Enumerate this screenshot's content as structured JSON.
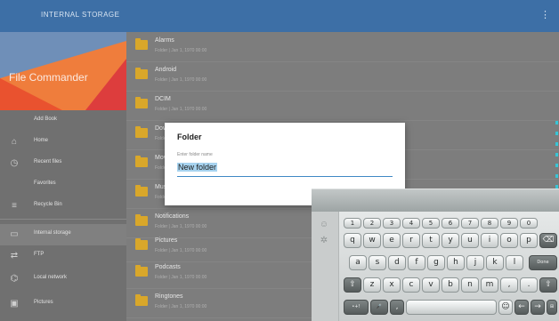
{
  "topbar": {
    "title": "INTERNAL STORAGE",
    "menu_icon": "more-vert-icon"
  },
  "sidebar": {
    "app_title": "File Commander",
    "items": [
      {
        "label": "Add Book",
        "icon": "add-icon"
      },
      {
        "label": "Home",
        "icon": "home-icon"
      },
      {
        "label": "Recent files",
        "icon": "clock-icon"
      },
      {
        "label": "Favorites",
        "icon": "star-icon"
      },
      {
        "label": "Recycle Bin",
        "icon": "trash-icon"
      },
      {
        "label": "Internal storage",
        "icon": "storage-icon"
      },
      {
        "label": "FTP",
        "icon": "ftp-icon"
      },
      {
        "label": "Local network",
        "icon": "network-icon"
      },
      {
        "label": "Pictures",
        "icon": "picture-icon"
      }
    ]
  },
  "files": [
    {
      "name": "Alarms",
      "meta": "Folder  |  Jan 1, 1970 00:00"
    },
    {
      "name": "Android",
      "meta": "Folder  |  Jan 1, 1970 00:00"
    },
    {
      "name": "DCIM",
      "meta": "Folder  |  Jan 1, 1970 00:00"
    },
    {
      "name": "Download",
      "meta": "Folder  |  Jan 1, 1970 00:00"
    },
    {
      "name": "Movies",
      "meta": "Folder  |  Jan 1, 1970 00:00"
    },
    {
      "name": "Music",
      "meta": "Folder  |  Jan 1, 1970 00:00"
    },
    {
      "name": "Notifications",
      "meta": "Folder  |  Jan 1, 1970 00:00"
    },
    {
      "name": "Pictures",
      "meta": "Folder  |  Jan 1, 1970 00:00"
    },
    {
      "name": "Podcasts",
      "meta": "Folder  |  Jan 1, 1970 00:00"
    },
    {
      "name": "Ringtones",
      "meta": "Folder  |  Jan 1, 1970 00:00"
    }
  ],
  "dialog": {
    "title": "Folder",
    "hint": "Enter folder name",
    "value": "New folder"
  },
  "keyboard": {
    "numbers": [
      "1",
      "2",
      "3",
      "4",
      "5",
      "6",
      "7",
      "8",
      "9",
      "0"
    ],
    "row1": [
      "q",
      "w",
      "e",
      "r",
      "t",
      "y",
      "u",
      "i",
      "o",
      "p"
    ],
    "row2": [
      "a",
      "s",
      "d",
      "f",
      "g",
      "h",
      "j",
      "k",
      "l"
    ],
    "row3": [
      "z",
      "x",
      "c",
      "v",
      "b",
      "n",
      "m",
      ",",
      "."
    ],
    "backspace": "⌫",
    "done": "Done",
    "shift": "⇧",
    "shift_right": "⇧",
    "symbols": "•+!",
    "mic": "🎤",
    "comma": ",",
    "space": "",
    "left": "←",
    "right": "→",
    "emoji": "☺",
    "layout": "⊞",
    "side_top": "☺",
    "side_bottom": "✲"
  }
}
